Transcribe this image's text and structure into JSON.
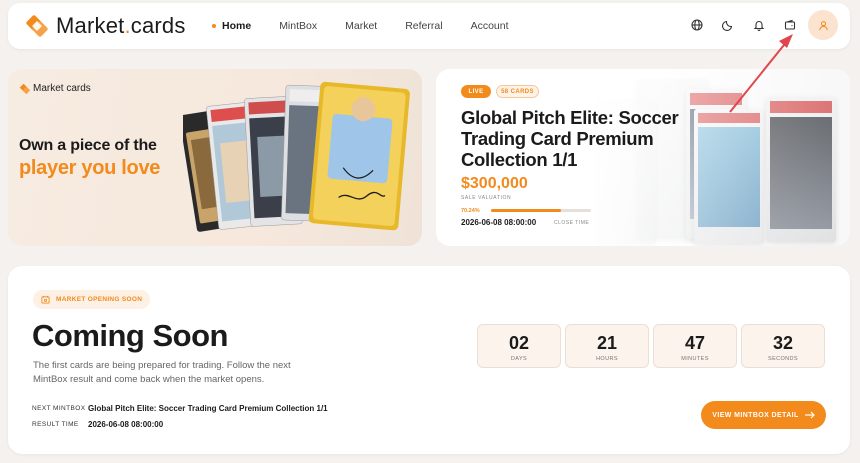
{
  "brand": {
    "name_part1": "Market",
    "name_dot": ".",
    "name_part2": "cards",
    "small": "Market cards"
  },
  "nav": {
    "links": [
      {
        "label": "Home",
        "active": true
      },
      {
        "label": "MintBox"
      },
      {
        "label": "Market"
      },
      {
        "label": "Referral"
      },
      {
        "label": "Account"
      }
    ],
    "icons": [
      "globe-icon",
      "moon-icon",
      "bell-icon",
      "wallet-icon",
      "user-icon"
    ]
  },
  "hero_left": {
    "title": "Own a piece of the",
    "accent": "player you love"
  },
  "hero_right": {
    "live": "LIVE",
    "cards": "58 CARDS",
    "title": "Global Pitch Elite: Soccer Trading Card Premium Collection 1/1",
    "price": "$300,000",
    "price_sub": "SALE VALUATION",
    "progress_pct": "70.24%",
    "progress": 70.24,
    "date": "2026-06-08 08:00:00",
    "close_label": "CLOSE TIME"
  },
  "main": {
    "badge": "MARKET OPENING SOON",
    "title": "Coming Soon",
    "description": "The first cards are being prepared for trading. Follow the next MintBox result and come back when the market opens.",
    "next_label": "NEXT MINTBOX",
    "next_value": "Global Pitch Elite: Soccer Trading Card Premium Collection 1/1",
    "result_label": "RESULT TIME",
    "result_value": "2026-06-08 08:00:00",
    "countdown": [
      {
        "value": "02",
        "label": "DAYS"
      },
      {
        "value": "21",
        "label": "HOURS"
      },
      {
        "value": "47",
        "label": "MINUTES"
      },
      {
        "value": "32",
        "label": "SECONDS"
      }
    ],
    "cta": "VIEW MINTBOX DETAIL"
  },
  "colors": {
    "accent": "#f28a1c",
    "bg": "#f4f1ee",
    "annotation": "#e0474c"
  }
}
